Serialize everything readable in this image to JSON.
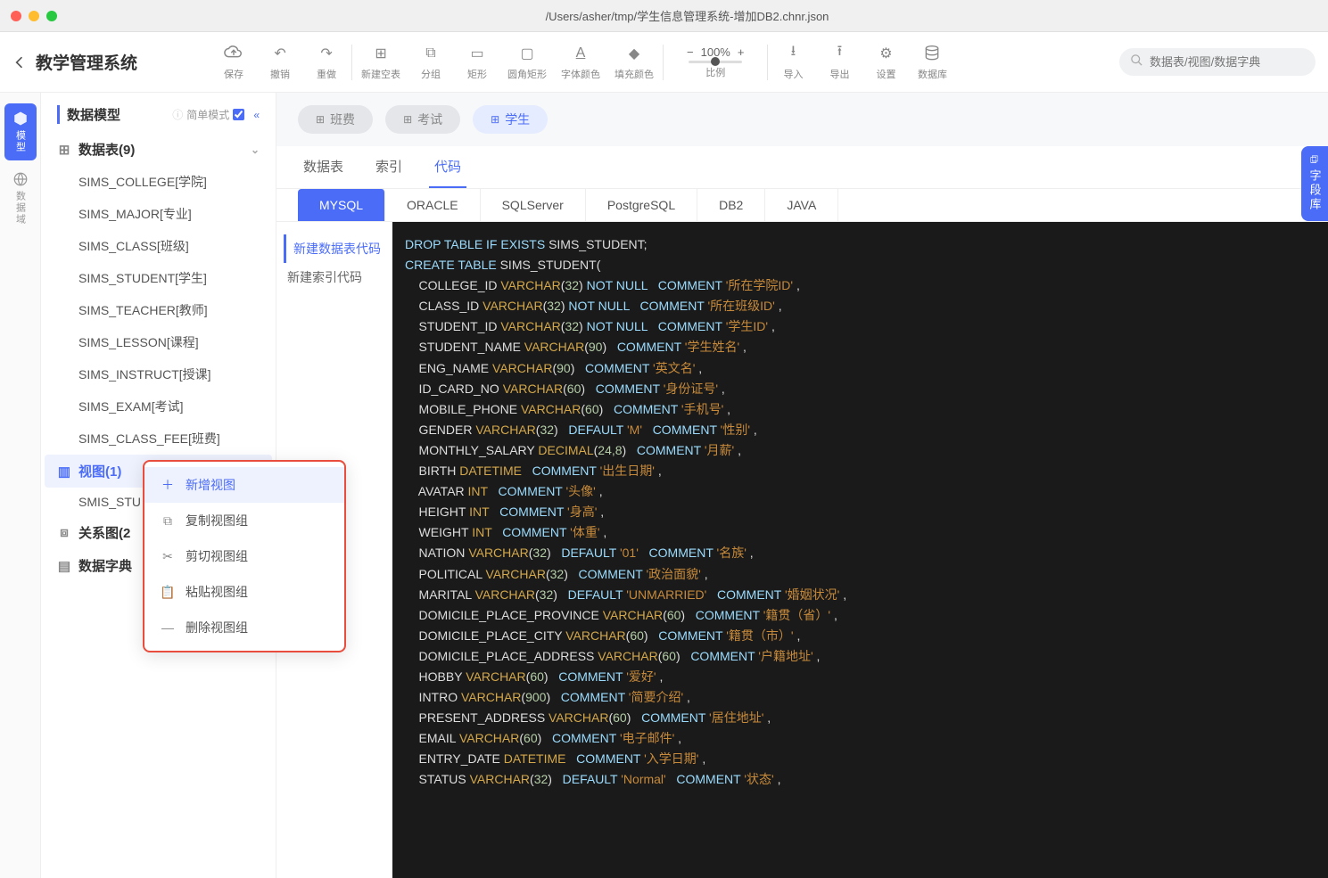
{
  "window": {
    "title": "/Users/asher/tmp/学生信息管理系统-增加DB2.chnr.json"
  },
  "header": {
    "app_title": "教学管理系统"
  },
  "toolbar": {
    "save": "保存",
    "undo": "撤销",
    "redo": "重做",
    "new_empty": "新建空表",
    "group": "分组",
    "rect": "矩形",
    "round_rect": "圆角矩形",
    "font_color": "字体颜色",
    "fill_color": "填充颜色",
    "zoom_label": "比例",
    "zoom_value": "100%",
    "import": "导入",
    "export": "导出",
    "settings": "设置",
    "database": "数据库"
  },
  "search": {
    "placeholder": "数据表/视图/数据字典"
  },
  "vtabs": {
    "model": "模型",
    "domain": "数据域"
  },
  "sidebar": {
    "title": "数据模型",
    "mode_label": "简单模式",
    "sections": {
      "tables": "数据表(9)",
      "views": "视图(1)",
      "relations": "关系图(2",
      "dicts": "数据字典"
    },
    "tables": [
      "SIMS_COLLEGE[学院]",
      "SIMS_MAJOR[专业]",
      "SIMS_CLASS[班级]",
      "SIMS_STUDENT[学生]",
      "SIMS_TEACHER[教师]",
      "SIMS_LESSON[课程]",
      "SIMS_INSTRUCT[授课]",
      "SIMS_EXAM[考试]",
      "SIMS_CLASS_FEE[班费]"
    ],
    "views": [
      "SMIS_STU"
    ]
  },
  "context_menu": {
    "add_view": "新增视图",
    "copy_group": "复制视图组",
    "cut_group": "剪切视图组",
    "paste_group": "粘贴视图组",
    "delete_group": "删除视图组"
  },
  "pills": {
    "class_fee": "班费",
    "exam": "考试",
    "student": "学生"
  },
  "inner_tabs": {
    "table": "数据表",
    "index": "索引",
    "code": "代码"
  },
  "db_tabs": [
    "MYSQL",
    "ORACLE",
    "SQLServer",
    "PostgreSQL",
    "DB2",
    "JAVA"
  ],
  "code_side": {
    "create_table": "新建数据表代码",
    "create_index": "新建索引代码"
  },
  "side_drawer": "字段库",
  "code_lines": [
    {
      "t": "plain",
      "raw": "DROP TABLE IF EXISTS SIMS_STUDENT;",
      "kw": [
        "DROP",
        "TABLE",
        "IF",
        "EXISTS"
      ]
    },
    {
      "t": "plain",
      "raw": "CREATE TABLE SIMS_STUDENT(",
      "kw": [
        "CREATE",
        "TABLE"
      ]
    },
    {
      "t": "col",
      "name": "COLLEGE_ID",
      "type": "VARCHAR",
      "size": "32",
      "extra": "NOT NULL",
      "comment": "'所在学院ID'"
    },
    {
      "t": "col",
      "name": "CLASS_ID",
      "type": "VARCHAR",
      "size": "32",
      "extra": "NOT NULL",
      "comment": "'所在班级ID'"
    },
    {
      "t": "col",
      "name": "STUDENT_ID",
      "type": "VARCHAR",
      "size": "32",
      "extra": "NOT NULL",
      "comment": "'学生ID'"
    },
    {
      "t": "col",
      "name": "STUDENT_NAME",
      "type": "VARCHAR",
      "size": "90",
      "comment": "'学生姓名'"
    },
    {
      "t": "col",
      "name": "ENG_NAME",
      "type": "VARCHAR",
      "size": "90",
      "comment": "'英文名'"
    },
    {
      "t": "col",
      "name": "ID_CARD_NO",
      "type": "VARCHAR",
      "size": "60",
      "comment": "'身份证号'"
    },
    {
      "t": "col",
      "name": "MOBILE_PHONE",
      "type": "VARCHAR",
      "size": "60",
      "comment": "'手机号'"
    },
    {
      "t": "col",
      "name": "GENDER",
      "type": "VARCHAR",
      "size": "32",
      "default": "'M'",
      "comment": "'性别'"
    },
    {
      "t": "col",
      "name": "MONTHLY_SALARY",
      "type": "DECIMAL",
      "size": "24,8",
      "comment": "'月薪'"
    },
    {
      "t": "col",
      "name": "BIRTH",
      "type": "DATETIME",
      "comment": "'出生日期'"
    },
    {
      "t": "col",
      "name": "AVATAR",
      "type": "INT",
      "comment": "'头像'"
    },
    {
      "t": "col",
      "name": "HEIGHT",
      "type": "INT",
      "comment": "'身高'"
    },
    {
      "t": "col",
      "name": "WEIGHT",
      "type": "INT",
      "comment": "'体重'"
    },
    {
      "t": "col",
      "name": "NATION",
      "type": "VARCHAR",
      "size": "32",
      "default": "'01'",
      "comment": "'名族'"
    },
    {
      "t": "col",
      "name": "POLITICAL",
      "type": "VARCHAR",
      "size": "32",
      "comment": "'政治面貌'"
    },
    {
      "t": "col",
      "name": "MARITAL",
      "type": "VARCHAR",
      "size": "32",
      "default": "'UNMARRIED'",
      "comment": "'婚姻状况'"
    },
    {
      "t": "col",
      "name": "DOMICILE_PLACE_PROVINCE",
      "type": "VARCHAR",
      "size": "60",
      "comment": "'籍贯（省）'"
    },
    {
      "t": "col",
      "name": "DOMICILE_PLACE_CITY",
      "type": "VARCHAR",
      "size": "60",
      "comment": "'籍贯（市）'"
    },
    {
      "t": "col",
      "name": "DOMICILE_PLACE_ADDRESS",
      "type": "VARCHAR",
      "size": "60",
      "comment": "'户籍地址'"
    },
    {
      "t": "col",
      "name": "HOBBY",
      "type": "VARCHAR",
      "size": "60",
      "comment": "'爱好'"
    },
    {
      "t": "col",
      "name": "INTRO",
      "type": "VARCHAR",
      "size": "900",
      "comment": "'简要介绍'"
    },
    {
      "t": "col",
      "name": "PRESENT_ADDRESS",
      "type": "VARCHAR",
      "size": "60",
      "comment": "'居住地址'"
    },
    {
      "t": "col",
      "name": "EMAIL",
      "type": "VARCHAR",
      "size": "60",
      "comment": "'电子邮件'"
    },
    {
      "t": "col",
      "name": "ENTRY_DATE",
      "type": "DATETIME",
      "comment": "'入学日期'"
    },
    {
      "t": "col",
      "name": "STATUS",
      "type": "VARCHAR",
      "size": "32",
      "default": "'Normal'",
      "comment": "'状态'"
    }
  ]
}
